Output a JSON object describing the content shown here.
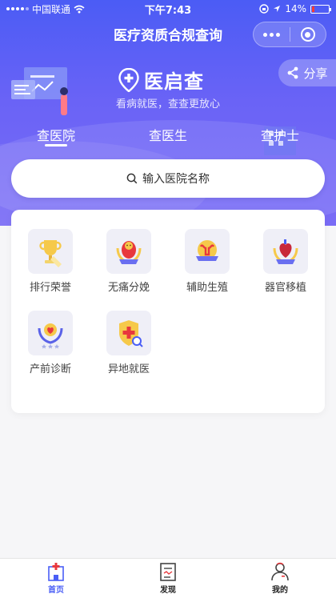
{
  "status_bar": {
    "carrier": "中国联通",
    "time": "下午7:43",
    "battery": "14%",
    "battery_level": 0.14
  },
  "nav": {
    "title": "医疗资质合规查询"
  },
  "hero": {
    "brand_name": "医启查",
    "slogan": "看病就医，查查更放心",
    "share_label": "分享"
  },
  "tabs": [
    {
      "label": "查医院",
      "active": true
    },
    {
      "label": "查医生",
      "active": false
    },
    {
      "label": "查护士",
      "active": false
    }
  ],
  "search": {
    "placeholder": "输入医院名称"
  },
  "categories": [
    {
      "label": "排行荣誉",
      "icon": "trophy-icon"
    },
    {
      "label": "无痛分娩",
      "icon": "baby-badge-icon"
    },
    {
      "label": "辅助生殖",
      "icon": "uterus-badge-icon"
    },
    {
      "label": "器官移植",
      "icon": "heart-organ-badge-icon"
    },
    {
      "label": "产前诊断",
      "icon": "heart-laurel-icon"
    },
    {
      "label": "异地就医",
      "icon": "shield-cross-icon"
    }
  ],
  "tabbar": [
    {
      "label": "首页",
      "icon": "hospital-icon",
      "active": true
    },
    {
      "label": "发现",
      "icon": "document-icon",
      "active": false
    },
    {
      "label": "我的",
      "icon": "doctor-icon",
      "active": false
    }
  ],
  "colors": {
    "primary": "#4a5ef6",
    "battery_low": "#ff3b30"
  }
}
